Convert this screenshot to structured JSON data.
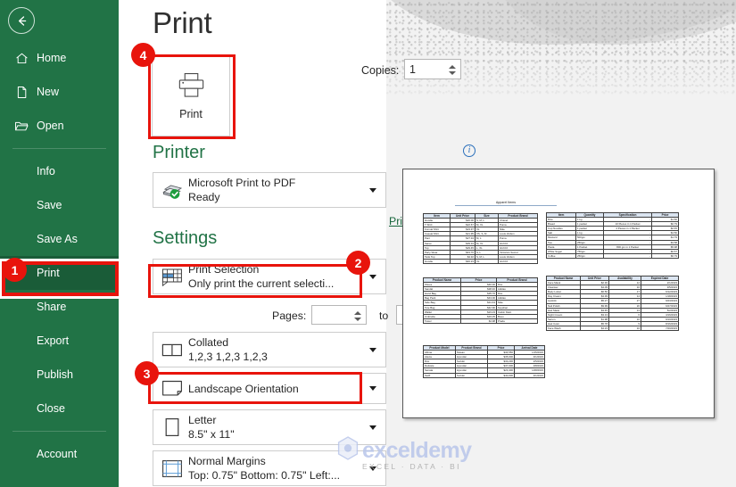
{
  "sidebar": {
    "back_icon": "back-arrow-icon",
    "items": [
      {
        "label": "Home",
        "icon": "home-icon",
        "has_icon": true,
        "active": false
      },
      {
        "label": "New",
        "icon": "page-icon",
        "has_icon": true,
        "active": false
      },
      {
        "label": "Open",
        "icon": "folder-icon",
        "has_icon": true,
        "active": false
      },
      {
        "label": "Info",
        "icon": "",
        "has_icon": false,
        "active": false
      },
      {
        "label": "Save",
        "icon": "",
        "has_icon": false,
        "active": false
      },
      {
        "label": "Save As",
        "icon": "",
        "has_icon": false,
        "active": false
      },
      {
        "label": "Print",
        "icon": "",
        "has_icon": false,
        "active": true
      },
      {
        "label": "Share",
        "icon": "",
        "has_icon": false,
        "active": false
      },
      {
        "label": "Export",
        "icon": "",
        "has_icon": false,
        "active": false
      },
      {
        "label": "Publish",
        "icon": "",
        "has_icon": false,
        "active": false
      },
      {
        "label": "Close",
        "icon": "",
        "has_icon": false,
        "active": false
      },
      {
        "label": "Account",
        "icon": "",
        "has_icon": false,
        "active": false
      }
    ]
  },
  "header": {
    "title": "Print"
  },
  "print_button": {
    "label": "Print",
    "icon": "printer-icon"
  },
  "copies": {
    "label": "Copies:",
    "value": "1",
    "placeholder": ""
  },
  "printer_section": {
    "heading": "Printer",
    "info_icon": "info-icon",
    "selected_name": "Microsoft Print to PDF",
    "status": "Ready",
    "icon": "printer-device-icon",
    "properties_link": "Printer Properties"
  },
  "settings_section": {
    "heading": "Settings",
    "rows": [
      {
        "title": "Print Selection",
        "subtitle": "Only print the current selecti...",
        "icon": "print-selection-icon",
        "highlighted": true
      },
      {
        "title": "Collated",
        "subtitle": "1,2,3   1,2,3   1,2,3",
        "icon": "collate-icon",
        "highlighted": false
      },
      {
        "title": "Landscape Orientation",
        "subtitle": "",
        "icon": "landscape-icon",
        "highlighted": true
      },
      {
        "title": "Letter",
        "subtitle": "8.5\" x 11\"",
        "icon": "paper-size-icon",
        "highlighted": false
      },
      {
        "title": "Normal Margins",
        "subtitle": "Top: 0.75\" Bottom: 0.75\" Left:...",
        "icon": "margins-icon",
        "highlighted": false
      }
    ],
    "pages": {
      "label": "Pages:",
      "from_value": "",
      "to_label": "to",
      "to_value": "",
      "placeholder": ""
    }
  },
  "annotations": {
    "colors": {
      "marker": "#e8140c",
      "brand_green": "#217346",
      "link_green": "#17663c"
    },
    "badges": [
      {
        "number": "1",
        "target": "sidebar-item-print"
      },
      {
        "number": "2",
        "target": "settings-row-print-selection"
      },
      {
        "number": "3",
        "target": "settings-row-orientation"
      },
      {
        "number": "4",
        "target": "print-button"
      }
    ]
  },
  "watermark": {
    "text": "exceldemy",
    "subtext": "EXCEL · DATA · BI",
    "logo_icon": "hex-logo-icon"
  },
  "preview": {
    "sheet_title": "Apparel Items",
    "tables": [
      {
        "name": "apparel-items-table",
        "headers": [
          "Item",
          "Unit Price",
          "Size",
          "Product Brand"
        ],
        "rows": [
          [
            "Hoodie",
            "$20.00",
            "S, M, L",
            "Chanel"
          ],
          [
            "T Shirt",
            "$22.67",
            "M, XL",
            "Puma"
          ],
          [
            "Formal Shirt",
            "$23.97",
            "XL",
            "Nike"
          ],
          [
            "Casual Shirt",
            "$21.95",
            "XS, S, M",
            "Louis Vuitton"
          ],
          [
            "Pant",
            "$27.34",
            "M, L",
            "Puma"
          ],
          [
            "Saree",
            "$39.34",
            "M, XL",
            "GUCCI"
          ],
          [
            "Top",
            "$29.45",
            "L, XL",
            "GUCCI"
          ],
          [
            "Party Wear",
            "$43.76",
            "S, L",
            "Victoria's Secret"
          ],
          [
            "Tank Top",
            "$4.32",
            "S, M, L",
            "Louis Vuitton"
          ],
          [
            "Hoodie",
            "$46.23",
            "XL",
            "GUCCI"
          ]
        ]
      },
      {
        "name": "grocery-items-table",
        "headers": [
          "Item",
          "Quantity",
          "Specification",
          "Price"
        ],
        "rows": [
          [
            "Rice",
            "1 kg",
            "-",
            "$1.60"
          ],
          [
            "Bread",
            "1 packet",
            "10 Pieces in 1 Packet",
            "$0.79"
          ],
          [
            "Cup Noodles",
            "1 packet",
            "4 Pieces in 1 Packet",
            "$2.45"
          ],
          [
            "Salt",
            "1 kg",
            "-",
            "$4.50"
          ],
          [
            "Mustard",
            "500gm",
            "-",
            "$1.79"
          ],
          [
            "Tea",
            "250gm",
            "-",
            "$3.58"
          ],
          [
            "Pasta",
            "1 Packet",
            "800 gm in 1 Packet",
            "$5.98"
          ],
          [
            "White Sugar",
            "750gm",
            "-",
            "$0.67"
          ],
          [
            "Coffee",
            "250gm",
            "-",
            "$6.79"
          ]
        ]
      },
      {
        "name": "accessories-table",
        "headers": [
          "Product Name",
          "Price",
          "Product Brand"
        ],
        "rows": [
          [
            "Shoes",
            "$46.30",
            "Dior"
          ],
          [
            "Sandal",
            "$38.40",
            "Adidas"
          ],
          [
            "Hand Bag",
            "$35.76",
            "Dior"
          ],
          [
            "Bag Pack",
            "$43.00",
            "Adidas"
          ],
          [
            "Side Bag",
            "$31.43",
            "Nike"
          ],
          [
            "Tote Bag",
            "$42.90",
            "Keyshan"
          ],
          [
            "Wallet",
            "$23.23",
            "Calvin Klein"
          ],
          [
            "Umbrella",
            "$33.25",
            "Bosu"
          ],
          [
            "Towel",
            "$4.98",
            "Prada"
          ]
        ]
      },
      {
        "name": "cosmetics-table",
        "headers": [
          "Product Name",
          "Unit Price",
          "Availability",
          "Expired Date"
        ],
        "rows": [
          [
            "Face Mask",
            "$2.30",
            "12",
            "2/1/2023"
          ],
          [
            "Cleanser",
            "$4.09",
            "10",
            "3/5/2023"
          ],
          [
            "Body Lotion",
            "$6.50",
            "17",
            "6/12/2023"
          ],
          [
            "Day Cream",
            "$4.39",
            "14",
            "1/18/2023"
          ],
          [
            "Lipstick",
            "$5.27",
            "27",
            "9/23/2023"
          ],
          [
            "Nail Polish",
            "$9.99",
            "20",
            "6/27/2023"
          ],
          [
            "Hair Mask",
            "$3.45",
            "13",
            "5/2/2023"
          ],
          [
            "Night Cream",
            "$3.13",
            "6",
            "4/16/2023"
          ],
          [
            "Serum",
            "$1.98",
            "10",
            "9/10/2023"
          ],
          [
            "Hair Color",
            "$5.78",
            "9",
            "8/16/2023"
          ],
          [
            "Face Wash",
            "$4.23",
            "16",
            "7/20/2023"
          ]
        ]
      },
      {
        "name": "vehicle-table",
        "headers": [
          "Product Model",
          "Product Brand",
          "Price",
          "Arrival Date"
        ],
        "rows": [
          [
            "Altima",
            "Nissan",
            "$34,550",
            "1/15/2023"
          ],
          [
            "Alevia",
            "Hyundai",
            "$35,000",
            "3/1/2023"
          ],
          [
            "Dior",
            "Suzuki",
            "$33,230",
            "2/5/2023"
          ],
          [
            "Delicate",
            "Hyundai",
            "$37,000",
            "3/8/2023"
          ],
          [
            "Senata",
            "Hyundai",
            "$23,400",
            "1/28/2023"
          ],
          [
            "Swift",
            "Suzuki",
            "$40,000",
            "3/1/2023"
          ]
        ]
      }
    ]
  }
}
